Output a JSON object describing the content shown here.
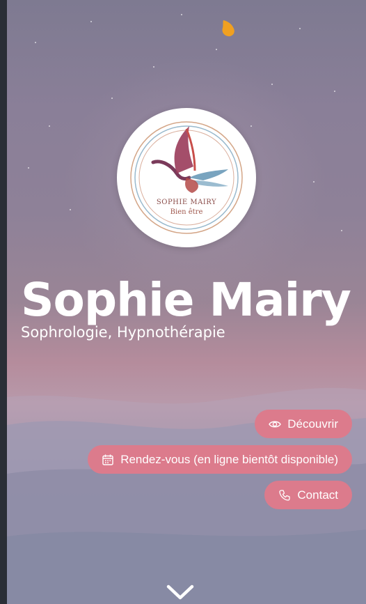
{
  "logo": {
    "name": "SOPHIE MAIRY",
    "tagline": "Bien être"
  },
  "hero": {
    "title": "Sophie Mairy",
    "subtitle": "Sophrologie, Hypnothérapie"
  },
  "actions": {
    "discover_label": "Découvrir",
    "appointment_label": "Rendez-vous (en ligne bientôt disponible)",
    "contact_label": "Contact"
  },
  "icons": {
    "corner": "drop-icon",
    "discover": "eye-icon",
    "appointment": "calendar-icon",
    "contact": "phone-icon",
    "scroll": "chevron-down-icon"
  },
  "colors": {
    "button": "#dc7b8c",
    "accent_drop": "#f0a020",
    "text": "#ffffff"
  }
}
